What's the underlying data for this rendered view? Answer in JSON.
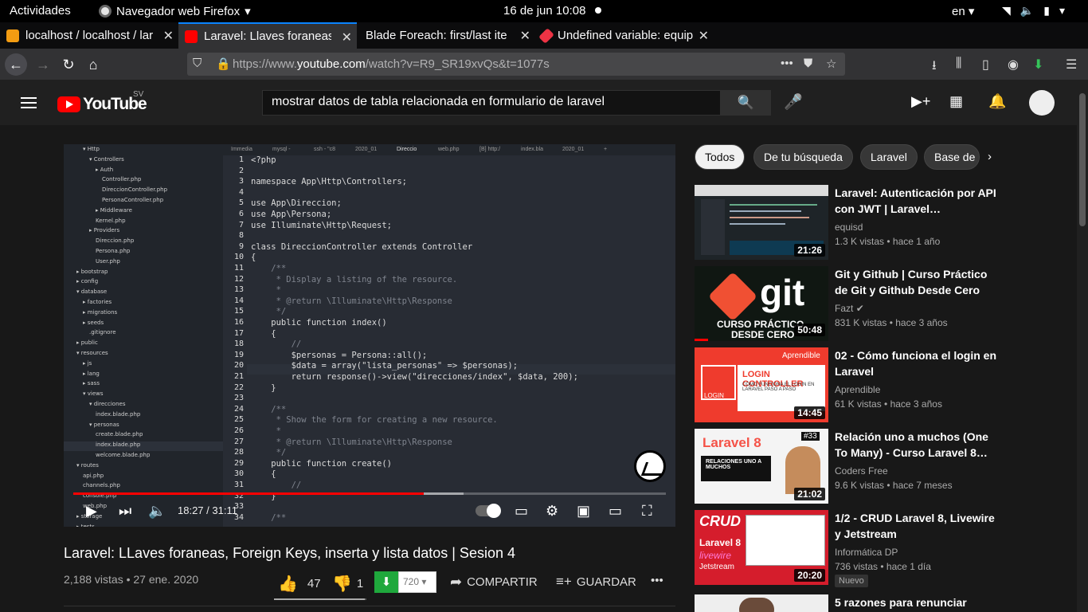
{
  "system": {
    "activities": "Actividades",
    "app_name": "Navegador web Firefox",
    "clock": "16 de jun  10:08",
    "lang": "en"
  },
  "tabs": [
    {
      "label": "localhost / localhost / lar"
    },
    {
      "label": "Laravel: Llaves foraneas"
    },
    {
      "label": "Blade Foreach: first/last ite"
    },
    {
      "label": "Undefined variable: equip"
    }
  ],
  "url": {
    "prefix": "https://www.",
    "domain": "youtube.com",
    "path": "/watch?v=R9_SR19xvQs&t=1077s"
  },
  "yt": {
    "logo_word": "YouTube",
    "country": "SV",
    "search_value": "mostrar datos de tabla relacionada en formulario de laravel"
  },
  "player": {
    "time_current": "18:27",
    "time_total": "31:11",
    "time_display": "18:27 / 31:11",
    "progress_fraction": 0.592,
    "buffer_fraction": 0.658,
    "editor_tabs": [
      "Immedia",
      "mysql -",
      "ssh - \"c8",
      "2020_01",
      "Direccio",
      "web.php",
      "[B] http:/",
      "index.bla",
      "2020_01",
      "+"
    ],
    "file_tree": [
      "▾ Http",
      "▾ Controllers",
      "▸ Auth",
      "Controller.php",
      "DireccionController.php",
      "PersonaController.php",
      "▸ Middleware",
      "Kernel.php",
      "▸ Providers",
      "Direccion.php",
      "Persona.php",
      "User.php",
      "▸ bootstrap",
      "▸ config",
      "▾ database",
      "▸ factories",
      "▸ migrations",
      "▸ seeds",
      ".gitignore",
      "▸ public",
      "▾ resources",
      "▸ js",
      "▸ lang",
      "▸ sass",
      "▾ views",
      "▾ direcciones",
      "index.blade.php",
      "▾ personas",
      "create.blade.php",
      "index.blade.php",
      "welcome.blade.php",
      "▾ routes",
      "api.php",
      "channels.php",
      "console.php",
      "web.php",
      "▸ storage",
      "▸ tests"
    ],
    "code_lines": [
      "<?php",
      "",
      "namespace App\\Http\\Controllers;",
      "",
      "use App\\Direccion;",
      "use App\\Persona;",
      "use Illuminate\\Http\\Request;",
      "",
      "class DireccionController extends Controller",
      "{",
      "    /**",
      "     * Display a listing of the resource.",
      "     *",
      "     * @return \\Illuminate\\Http\\Response",
      "     */",
      "    public function index()",
      "    {",
      "        //",
      "        $personas = Persona::all();",
      "        $data = array(\"lista_personas\" => $personas);",
      "        return response()->view(\"direcciones/index\", $data, 200);",
      "    }",
      "",
      "    /**",
      "     * Show the form for creating a new resource.",
      "     *",
      "     * @return \\Illuminate\\Http\\Response",
      "     */",
      "    public function create()",
      "    {",
      "        //",
      "    }",
      "",
      "    /**"
    ]
  },
  "video": {
    "title": "Laravel: LLaves foraneas, Foreign Keys, inserta y lista datos | Sesion 4",
    "meta": "2,188 vistas • 27 ene. 2020",
    "likes": "47",
    "dislikes": "1",
    "like_fraction": 0.979,
    "quality": "720",
    "share": "COMPARTIR",
    "save": "GUARDAR"
  },
  "chips": [
    "Todos",
    "De tu búsqueda",
    "Laravel",
    "Base de"
  ],
  "recommendations": [
    {
      "title": "Laravel: Autenticación por API con JWT | Laravel…",
      "channel": "equisd",
      "stats": "1.3 K vistas • hace 1 año",
      "duration": "21:26",
      "verified": false,
      "badge": ""
    },
    {
      "title": "Git y Github | Curso Práctico de Git y Github Desde Cero",
      "channel": "Fazt",
      "stats": "831 K vistas • hace 3 años",
      "duration": "50:48",
      "verified": true,
      "badge": "",
      "thumb_text": [
        "git",
        "CURSO PRÁCTICO",
        "DESDE CERO"
      ]
    },
    {
      "title": "02 - Cómo funciona el login en Laravel",
      "channel": "Aprendible",
      "stats": "61 K vistas • hace 3 años",
      "duration": "14:45",
      "verified": false,
      "badge": "",
      "thumb_text": [
        "Aprendible",
        "LOGIN CONTROLLER",
        "CÓMO FUNCIONA EL LOGIN EN LARAVEL PASO A PASO",
        "LOGIN"
      ]
    },
    {
      "title": "Relación uno a muchos (One To Many) - Curso Laravel 8…",
      "channel": "Coders Free",
      "stats": "9.6 K vistas • hace 7 meses",
      "duration": "21:02",
      "verified": false,
      "badge": "",
      "thumb_text": [
        "Laravel 8",
        "#33",
        "RELACIONES UNO A MUCHOS"
      ]
    },
    {
      "title": "1/2 - CRUD Laravel 8, Livewire y Jetstream",
      "channel": "Informática DP",
      "stats": "736 vistas • hace 1 día",
      "duration": "20:20",
      "verified": false,
      "badge": "Nuevo",
      "thumb_text": [
        "CRUD",
        "Laravel 8",
        "livewire",
        "Jetstream"
      ]
    },
    {
      "title": "5 razones para renunciar",
      "channel": "",
      "stats": "",
      "duration": "",
      "verified": false,
      "badge": ""
    }
  ]
}
